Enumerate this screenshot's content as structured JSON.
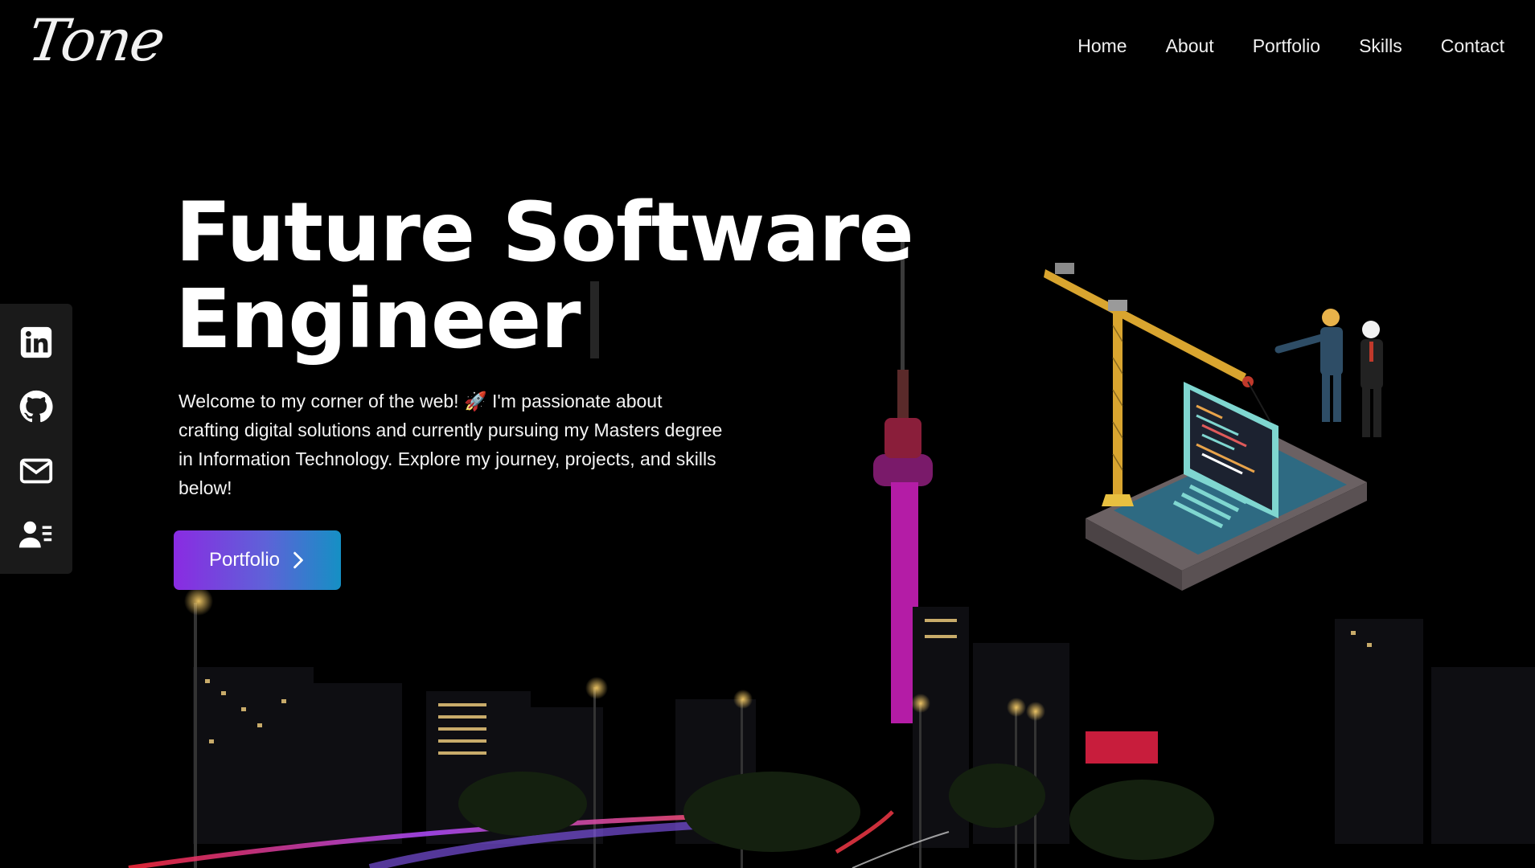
{
  "header": {
    "logo": "Tone",
    "nav": [
      "Home",
      "About",
      "Portfolio",
      "Skills",
      "Contact"
    ]
  },
  "social": [
    {
      "name": "linkedin-icon"
    },
    {
      "name": "github-icon"
    },
    {
      "name": "mail-icon"
    },
    {
      "name": "resume-icon"
    }
  ],
  "hero": {
    "title_line1": "Future Software",
    "title_line2": "Engineer",
    "intro": "Welcome to my corner of the web! 🚀 I'm passionate about crafting digital solutions and currently pursuing my Masters degree in Information Technology. Explore my journey, projects, and skills below!",
    "cta_label": "Portfolio"
  },
  "colors": {
    "background": "#000000",
    "cta_gradient_start": "#8a2be2",
    "cta_gradient_end": "#1590c4",
    "sidebar": "#1a1a1a"
  }
}
